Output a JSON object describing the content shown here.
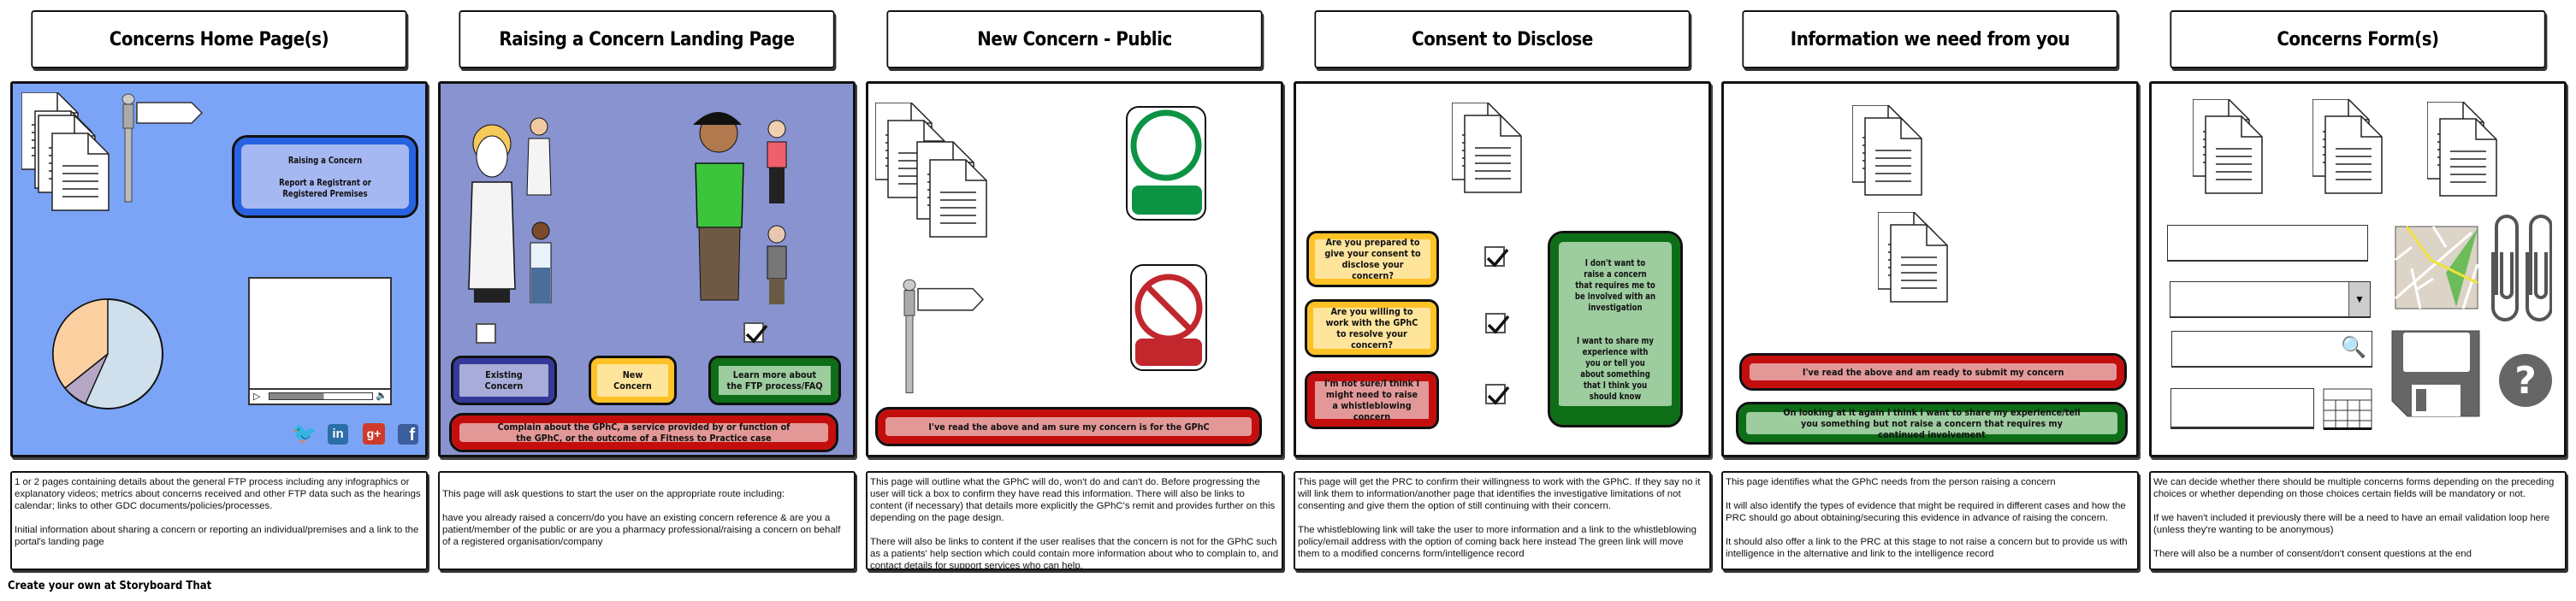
{
  "panels": [
    {
      "title": "Concerns Home Page(s)",
      "background": "#7ba4f7",
      "button": {
        "line1": "Raising a Concern",
        "line2": "Report a Registrant or Registered Premises"
      },
      "social_icons": [
        "twitter-icon",
        "linkedin-icon",
        "google-plus-icon",
        "facebook-icon"
      ],
      "description": "1 or 2 pages containing details about the general FTP process including any infographics or explanatory videos; metrics about concerns received and other FTP data such as the hearings calendar; links to other GDC documents/policies/processes.\n\nInitial information about sharing a concern or reporting an individual/premises and a link to the portal's landing page"
    },
    {
      "title": "Raising a Concern Landing Page",
      "background": "#8893cf",
      "checkbox_left_checked": false,
      "checkbox_right_checked": true,
      "buttons": {
        "existing": "Existing Concern",
        "new": "New Concern",
        "learn": "Learn more about the FTP process/FAQ",
        "complain": "Complain about the GPhC, a service provided by or function of the GPhC, or the outcome of a Fitness to Practice case"
      },
      "description": "\nThis page will ask questions to start the user on the appropriate route including:\n\nhave you already raised a concern/do you have an existing concern reference & are you a patient/member of the public or are you a pharmacy professional/raising a concern on behalf of a registered organisation/company"
    },
    {
      "title": "New Concern - Public",
      "button": "I've read the above and am sure my concern is for the GPhC",
      "description": "This page will outline what the GPhC will do, won't do and can't do. Before progressing the user will tick a box to confirm they have read this information. There will also be links to content (if necessary) that details more explicitly the GPhC's remit and provides further on this depending on the page design.\n\nThere will also be links to content if the user realises that the concern is not for the GPhC such as a patients' help section which could contain more information about who to complain to, and contact details for support services who can help."
    },
    {
      "title": "Consent to Disclose",
      "questions": [
        "Are you prepared to give your consent to disclose your concern?",
        "Are you willing to work with the GPhC to resolve your concern?",
        "I'm not sure/I think I might need to raise a whistleblowing concern"
      ],
      "green_box": {
        "line1": "I don't want to raise a concern that requires me to be involved with an investigation",
        "line2": "I want to share my experience with you or tell you about something that I think you should know"
      },
      "description": "This page will get the PRC to confirm their willingness to work with the GPhC. If they say no it will link them to information/another page that identifies the investigative limitations of not consenting and give them the option of still continuing with their concern.\n\nThe whistleblowing link will take the user to more information and a link to the whistleblowing policy/email address with the option of coming back here instead The green link will move them to a modified concerns form/intelligence record"
    },
    {
      "title": "Information we need from you",
      "buttons": {
        "submit": "I've read the above and am ready to submit my concern",
        "share": "On looking at it again I think I want to share my experience/tell you something but not raise a concern that requires my continued involvement"
      },
      "description": "This page identifies what the GPhC needs from the person raising a concern\n\nIt will also identify the types of evidence that might be required in different cases and how the PRC should go about obtaining/securing this evidence in advance of raising the concern.\n\nIt should also offer a link to the PRC at this stage to not raise a concern but to provide us with intelligence in the alternative and link to the intelligence record"
    },
    {
      "title": "Concerns Form(s)",
      "description": "We can decide whether there should be multiple concerns forms depending on the preceding choices or whether depending on those choices certain fields will be mandatory or not.\n\nIf we haven't included it previously there will be a need to have an email validation loop here (unless they're wanting to be anonymous)\n\nThere will also be a number of consent/don't consent questions at the end"
    }
  ],
  "footer": "Create your own at Storyboard That"
}
